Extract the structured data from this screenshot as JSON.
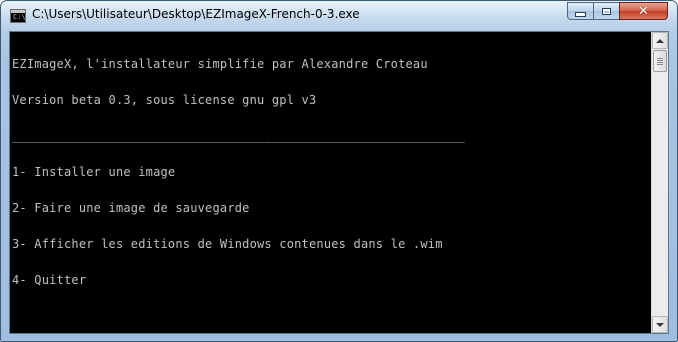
{
  "window": {
    "title": "C:\\Users\\Utilisateur\\Desktop\\EZImageX-French-0-3.exe",
    "icon": "console-app-icon",
    "controls": {
      "minimize_icon": "minimize-icon",
      "maximize_icon": "maximize-icon",
      "close_icon": "close-icon",
      "close_glyph": "✕"
    }
  },
  "console": {
    "lines": [
      "EZImageX, l'installateur simplifie par Alexandre Croteau",
      "Version beta 0.3, sous license gnu gpl v3",
      "_____________________________________________________________",
      "1- Installer une image",
      "2- Faire une image de sauvegarde",
      "3- Afficher les editions de Windows contenues dans le .wim",
      "4- Quitter"
    ],
    "text_color": "#c0c0c0",
    "background": "#000000"
  },
  "scrollbar": {
    "up_icon": "scroll-up-arrow-icon",
    "down_icon": "scroll-down-arrow-icon"
  }
}
